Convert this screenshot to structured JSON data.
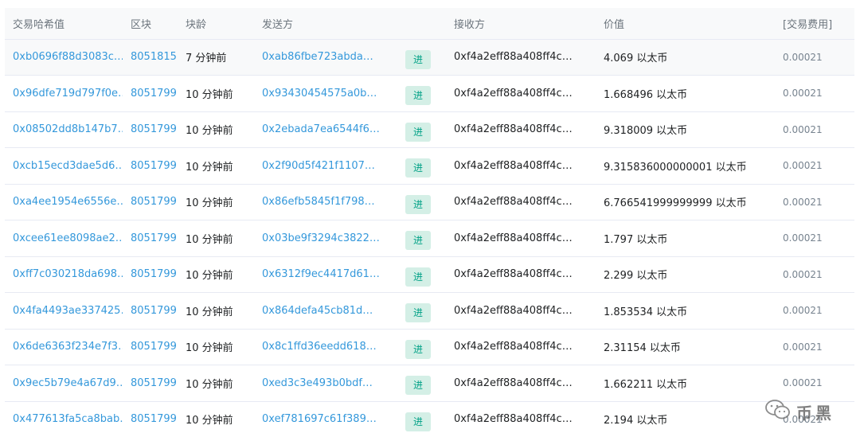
{
  "headers": {
    "hash": "交易哈希值",
    "block": "区块",
    "age": "块龄",
    "from": "发送方",
    "to": "接收方",
    "value": "价值",
    "fee": "[交易费用]"
  },
  "rows": [
    {
      "hash": "0xb0696f88d3083c…",
      "block": "8051815",
      "age": "7 分钟前",
      "from": "0xab86fbe723abda…",
      "direction": "进",
      "to": "0xf4a2eff88a408ff4c…",
      "value": "4.069 以太币",
      "fee": "0.00021"
    },
    {
      "hash": "0x96dfe719d797f0e…",
      "block": "8051799",
      "age": "10 分钟前",
      "from": "0x93430454575a0b…",
      "direction": "进",
      "to": "0xf4a2eff88a408ff4c…",
      "value": "1.668496 以太币",
      "fee": "0.00021"
    },
    {
      "hash": "0x08502dd8b147b7…",
      "block": "8051799",
      "age": "10 分钟前",
      "from": "0x2ebada7ea6544f6…",
      "direction": "进",
      "to": "0xf4a2eff88a408ff4c…",
      "value": "9.318009 以太币",
      "fee": "0.00021"
    },
    {
      "hash": "0xcb15ecd3dae5d6…",
      "block": "8051799",
      "age": "10 分钟前",
      "from": "0x2f90d5f421f1107…",
      "direction": "进",
      "to": "0xf4a2eff88a408ff4c…",
      "value": "9.315836000000001 以太币",
      "fee": "0.00021"
    },
    {
      "hash": "0xa4ee1954e6556e…",
      "block": "8051799",
      "age": "10 分钟前",
      "from": "0x86efb5845f1f798…",
      "direction": "进",
      "to": "0xf4a2eff88a408ff4c…",
      "value": "6.766541999999999 以太币",
      "fee": "0.00021"
    },
    {
      "hash": "0xcee61ee8098ae2…",
      "block": "8051799",
      "age": "10 分钟前",
      "from": "0x03be9f3294c3822…",
      "direction": "进",
      "to": "0xf4a2eff88a408ff4c…",
      "value": "1.797 以太币",
      "fee": "0.00021"
    },
    {
      "hash": "0xff7c030218da698…",
      "block": "8051799",
      "age": "10 分钟前",
      "from": "0x6312f9ec4417d61…",
      "direction": "进",
      "to": "0xf4a2eff88a408ff4c…",
      "value": "2.299 以太币",
      "fee": "0.00021"
    },
    {
      "hash": "0x4fa4493ae337425…",
      "block": "8051799",
      "age": "10 分钟前",
      "from": "0x864defa45cb81d…",
      "direction": "进",
      "to": "0xf4a2eff88a408ff4c…",
      "value": "1.853534 以太币",
      "fee": "0.00021"
    },
    {
      "hash": "0x6de6363f234e7f3…",
      "block": "8051799",
      "age": "10 分钟前",
      "from": "0x8c1ffd36eedd618…",
      "direction": "进",
      "to": "0xf4a2eff88a408ff4c…",
      "value": "2.31154 以太币",
      "fee": "0.00021"
    },
    {
      "hash": "0x9ec5b79e4a67d9…",
      "block": "8051799",
      "age": "10 分钟前",
      "from": "0xed3c3e493b0bdf…",
      "direction": "进",
      "to": "0xf4a2eff88a408ff4c…",
      "value": "1.662211 以太币",
      "fee": "0.00021"
    },
    {
      "hash": "0x477613fa5ca8bab…",
      "block": "8051799",
      "age": "10 分钟前",
      "from": "0xef781697c61f389…",
      "direction": "进",
      "to": "0xf4a2eff88a408ff4c…",
      "value": "2.194 以太币",
      "fee": "0.00021"
    }
  ],
  "watermark": {
    "text": "币黑",
    "icon": "wechat-icon"
  },
  "colors": {
    "link": "#3498db",
    "badge_bg": "#d4efe6",
    "badge_text": "#00a186",
    "header_bg": "#f8f9fa",
    "highlight_row": "#f8f9fa"
  }
}
